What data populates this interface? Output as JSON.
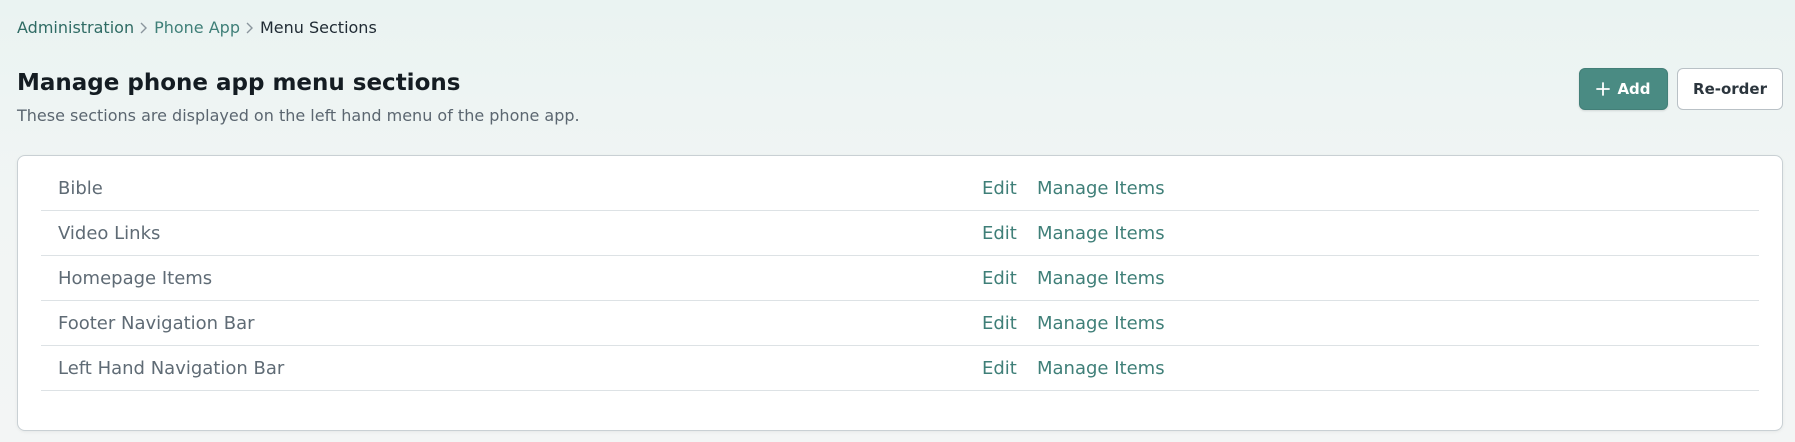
{
  "breadcrumb": {
    "items": [
      {
        "label": "Administration"
      },
      {
        "label": "Phone App"
      }
    ],
    "current": "Menu Sections"
  },
  "header": {
    "title": "Manage phone app menu sections",
    "subtitle": "These sections are displayed on the left hand menu of the phone app."
  },
  "toolbar": {
    "add_label": "Add",
    "reorder_label": "Re-order"
  },
  "sections": [
    {
      "name": "Bible",
      "edit_label": "Edit",
      "manage_label": "Manage Items"
    },
    {
      "name": "Video Links",
      "edit_label": "Edit",
      "manage_label": "Manage Items"
    },
    {
      "name": "Homepage Items",
      "edit_label": "Edit",
      "manage_label": "Manage Items"
    },
    {
      "name": "Footer Navigation Bar",
      "edit_label": "Edit",
      "manage_label": "Manage Items"
    },
    {
      "name": "Left Hand Navigation Bar",
      "edit_label": "Edit",
      "manage_label": "Manage Items"
    }
  ],
  "icons": {
    "breadcrumb_separator": "chevron-right-icon",
    "add": "plus-icon"
  },
  "colors": {
    "accent": "#4a8b83",
    "link": "#3f7f78",
    "text_muted": "#5f6b75"
  }
}
